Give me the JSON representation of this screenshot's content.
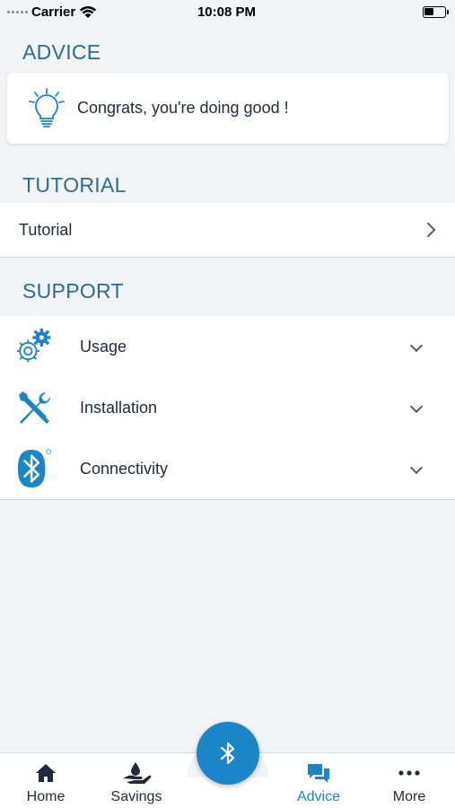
{
  "status_bar": {
    "carrier": "Carrier",
    "time": "10:08 PM",
    "battery_level": 0.45
  },
  "advice": {
    "title": "ADVICE",
    "message": "Congrats, you're doing good !",
    "icon": "lightbulb-icon"
  },
  "tutorial": {
    "title": "TUTORIAL",
    "item_label": "Tutorial"
  },
  "support": {
    "title": "SUPPORT",
    "items": [
      {
        "label": "Usage",
        "icon": "gears-icon"
      },
      {
        "label": "Installation",
        "icon": "tools-icon"
      },
      {
        "label": "Connectivity",
        "icon": "bluetooth-icon"
      }
    ]
  },
  "tab_bar": {
    "tabs": [
      {
        "label": "Home",
        "icon": "home-icon",
        "active": false
      },
      {
        "label": "Savings",
        "icon": "savings-icon",
        "active": false
      },
      {
        "label": "Advice",
        "icon": "chat-icon",
        "active": true
      },
      {
        "label": "More",
        "icon": "more-icon",
        "active": false
      }
    ],
    "center_button_icon": "bluetooth-icon"
  },
  "colors": {
    "accent": "#1a86c8",
    "section_title": "#2d6b94",
    "background": "#f1f4f7",
    "text": "#1e2b38"
  }
}
